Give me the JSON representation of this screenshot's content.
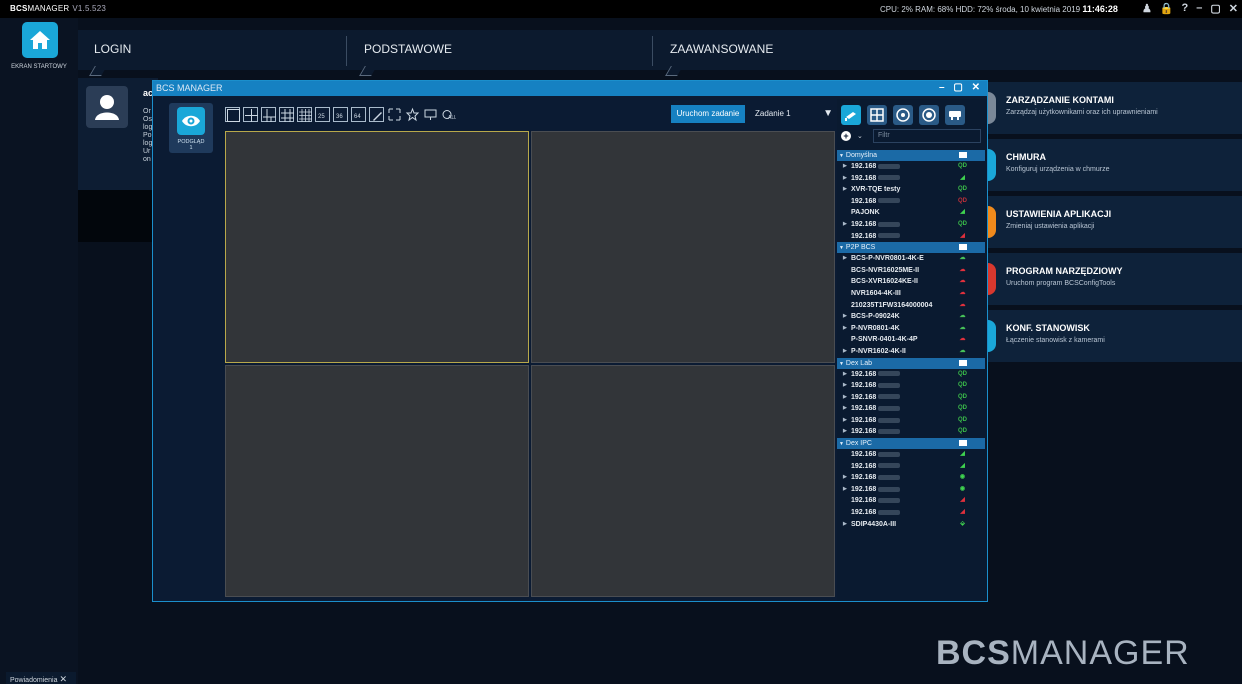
{
  "topbar": {
    "app_bold": "BCS",
    "app_rest": "MANAGER",
    "version": "V1.5.523",
    "stats": "CPU:  2%  RAM: 68%  HDD: 72%   środa, 10 kwietnia 2019",
    "time": "11:46:28",
    "controls": [
      "♟",
      "🔒",
      "?",
      "–",
      "▢",
      "✕"
    ]
  },
  "home": {
    "label": "EKRAN STARTOWY"
  },
  "nav": {
    "tabs": [
      "LOGIN",
      "PODSTAWOWE",
      "ZAAWANSOWANE"
    ]
  },
  "profile": {
    "title": "ac",
    "lines": [
      "Or",
      "Os",
      "log",
      "Po",
      "log",
      "Ur",
      "on"
    ]
  },
  "cards": [
    {
      "title": "ZARZĄDZANIE KONTAMI",
      "sub": "Zarządzaj użytkownikami oraz ich uprawnieniami",
      "color": "#7a8898"
    },
    {
      "title": "CHMURA",
      "sub": "Konfiguruj urządzenia w chmurze",
      "color": "#1aa7d8"
    },
    {
      "title": "USTAWIENIA APLIKACJI",
      "sub": "Zmieniaj ustawienia aplikacji",
      "color": "#f08a1c"
    },
    {
      "title": "PROGRAM NARZĘDZIOWY",
      "sub": "Uruchom program BCSConfigTools",
      "color": "#d8382e"
    },
    {
      "title": "KONF. STANOWISK",
      "sub": "Łączenie stanowisk z kamerami",
      "color": "#1aa7d8"
    }
  ],
  "brand": {
    "bold": "BCS",
    "rest": "MANAGER"
  },
  "notif": {
    "label": "Powiadomienia"
  },
  "window": {
    "title": "BCS MANAGER",
    "controls": "– ▢ ✕",
    "preview_label": "PODGLĄD",
    "preview_num": "1",
    "run_label": "Uruchom zadanie",
    "task": "Zadanie 1",
    "filter_placeholder": "Filtr",
    "tools": [
      "1",
      "4",
      "6",
      "9",
      "16",
      "25",
      "36",
      "64",
      "edit",
      "full",
      "star",
      "mon",
      "all"
    ]
  },
  "tree": [
    {
      "group": "Domyślna",
      "items": [
        {
          "name": "192.168",
          "arrow": true,
          "blur": true,
          "st": "qd"
        },
        {
          "name": "192.168",
          "arrow": true,
          "blur": true,
          "st": "cam-g"
        },
        {
          "name": "XVR-TQE testy",
          "arrow": true,
          "blur": false,
          "st": "qd"
        },
        {
          "name": "192.168",
          "arrow": false,
          "blur": true,
          "st": "qd-r"
        },
        {
          "name": "PAJONK",
          "arrow": false,
          "blur": false,
          "st": "cam-g"
        },
        {
          "name": "192.168",
          "arrow": true,
          "blur": true,
          "st": "qd"
        },
        {
          "name": "192.168",
          "arrow": false,
          "blur": true,
          "st": "cam-r"
        }
      ]
    },
    {
      "group": "P2P BCS",
      "items": [
        {
          "name": "BCS-P-NVR0801-4K-E",
          "arrow": true,
          "blur": false,
          "st": "cl-g"
        },
        {
          "name": "BCS-NVR16025ME-II",
          "arrow": false,
          "blur": false,
          "st": "cl-r"
        },
        {
          "name": "BCS-XVR16024KE-II",
          "arrow": false,
          "blur": false,
          "st": "cl-r"
        },
        {
          "name": "NVR1604-4K-III",
          "arrow": false,
          "blur": false,
          "st": "cl-r"
        },
        {
          "name": "210235T1FW3164000004",
          "arrow": false,
          "blur": false,
          "st": "cl-r"
        },
        {
          "name": "BCS-P-09024K",
          "arrow": true,
          "blur": false,
          "st": "cl-g"
        },
        {
          "name": "P-NVR0801-4K",
          "arrow": true,
          "blur": false,
          "st": "cl-g"
        },
        {
          "name": "P-SNVR-0401-4K-4P",
          "arrow": false,
          "blur": false,
          "st": "cl-r"
        },
        {
          "name": "P-NVR1602-4K-II",
          "arrow": true,
          "blur": false,
          "st": "cl-g"
        }
      ]
    },
    {
      "group": "Dex Lab",
      "items": [
        {
          "name": "192.168",
          "arrow": true,
          "blur": true,
          "st": "qd"
        },
        {
          "name": "192.168",
          "arrow": true,
          "blur": true,
          "st": "qd"
        },
        {
          "name": "192.168",
          "arrow": true,
          "blur": true,
          "st": "qd"
        },
        {
          "name": "192.168",
          "arrow": true,
          "blur": true,
          "st": "qd"
        },
        {
          "name": "192.168",
          "arrow": true,
          "blur": true,
          "st": "qd"
        },
        {
          "name": "192.168",
          "arrow": true,
          "blur": true,
          "st": "qd"
        }
      ]
    },
    {
      "group": "Dex IPC",
      "items": [
        {
          "name": "192.168",
          "arrow": false,
          "blur": true,
          "st": "cam-g"
        },
        {
          "name": "192.168",
          "arrow": false,
          "blur": true,
          "st": "cam-g"
        },
        {
          "name": "192.168",
          "arrow": true,
          "blur": true,
          "st": "dot-g"
        },
        {
          "name": "192.168",
          "arrow": true,
          "blur": true,
          "st": "dot-g"
        },
        {
          "name": "192.168",
          "arrow": false,
          "blur": true,
          "st": "cam-r"
        },
        {
          "name": "192.168",
          "arrow": false,
          "blur": true,
          "st": "cam-r"
        },
        {
          "name": "SDIP4430A-III",
          "arrow": true,
          "blur": false,
          "st": "dome-g"
        }
      ]
    }
  ]
}
